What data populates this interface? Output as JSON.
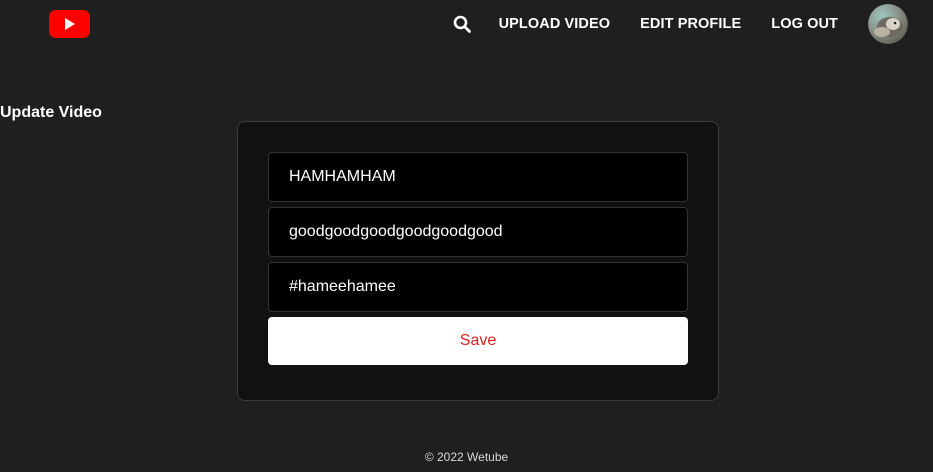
{
  "header": {
    "logo_icon": "youtube-logo-icon",
    "search_icon": "search-icon",
    "nav": {
      "upload_video": "UPLOAD VIDEO",
      "edit_profile": "EDIT PROFILE",
      "log_out": "LOG OUT"
    },
    "avatar_icon": "avatar"
  },
  "page": {
    "title": "Update Video"
  },
  "form": {
    "title_value": "HAMHAMHAM",
    "description_value": "goodgoodgoodgoodgoodgood",
    "hashtags_value": "#hameehamee",
    "save_label": "Save"
  },
  "footer": {
    "copyright": "© 2022 Wetube"
  },
  "colors": {
    "background": "#1f1f1f",
    "card_background": "#111111",
    "field_background": "#000000",
    "brand_red": "#ff0000",
    "save_text": "#e02020"
  }
}
